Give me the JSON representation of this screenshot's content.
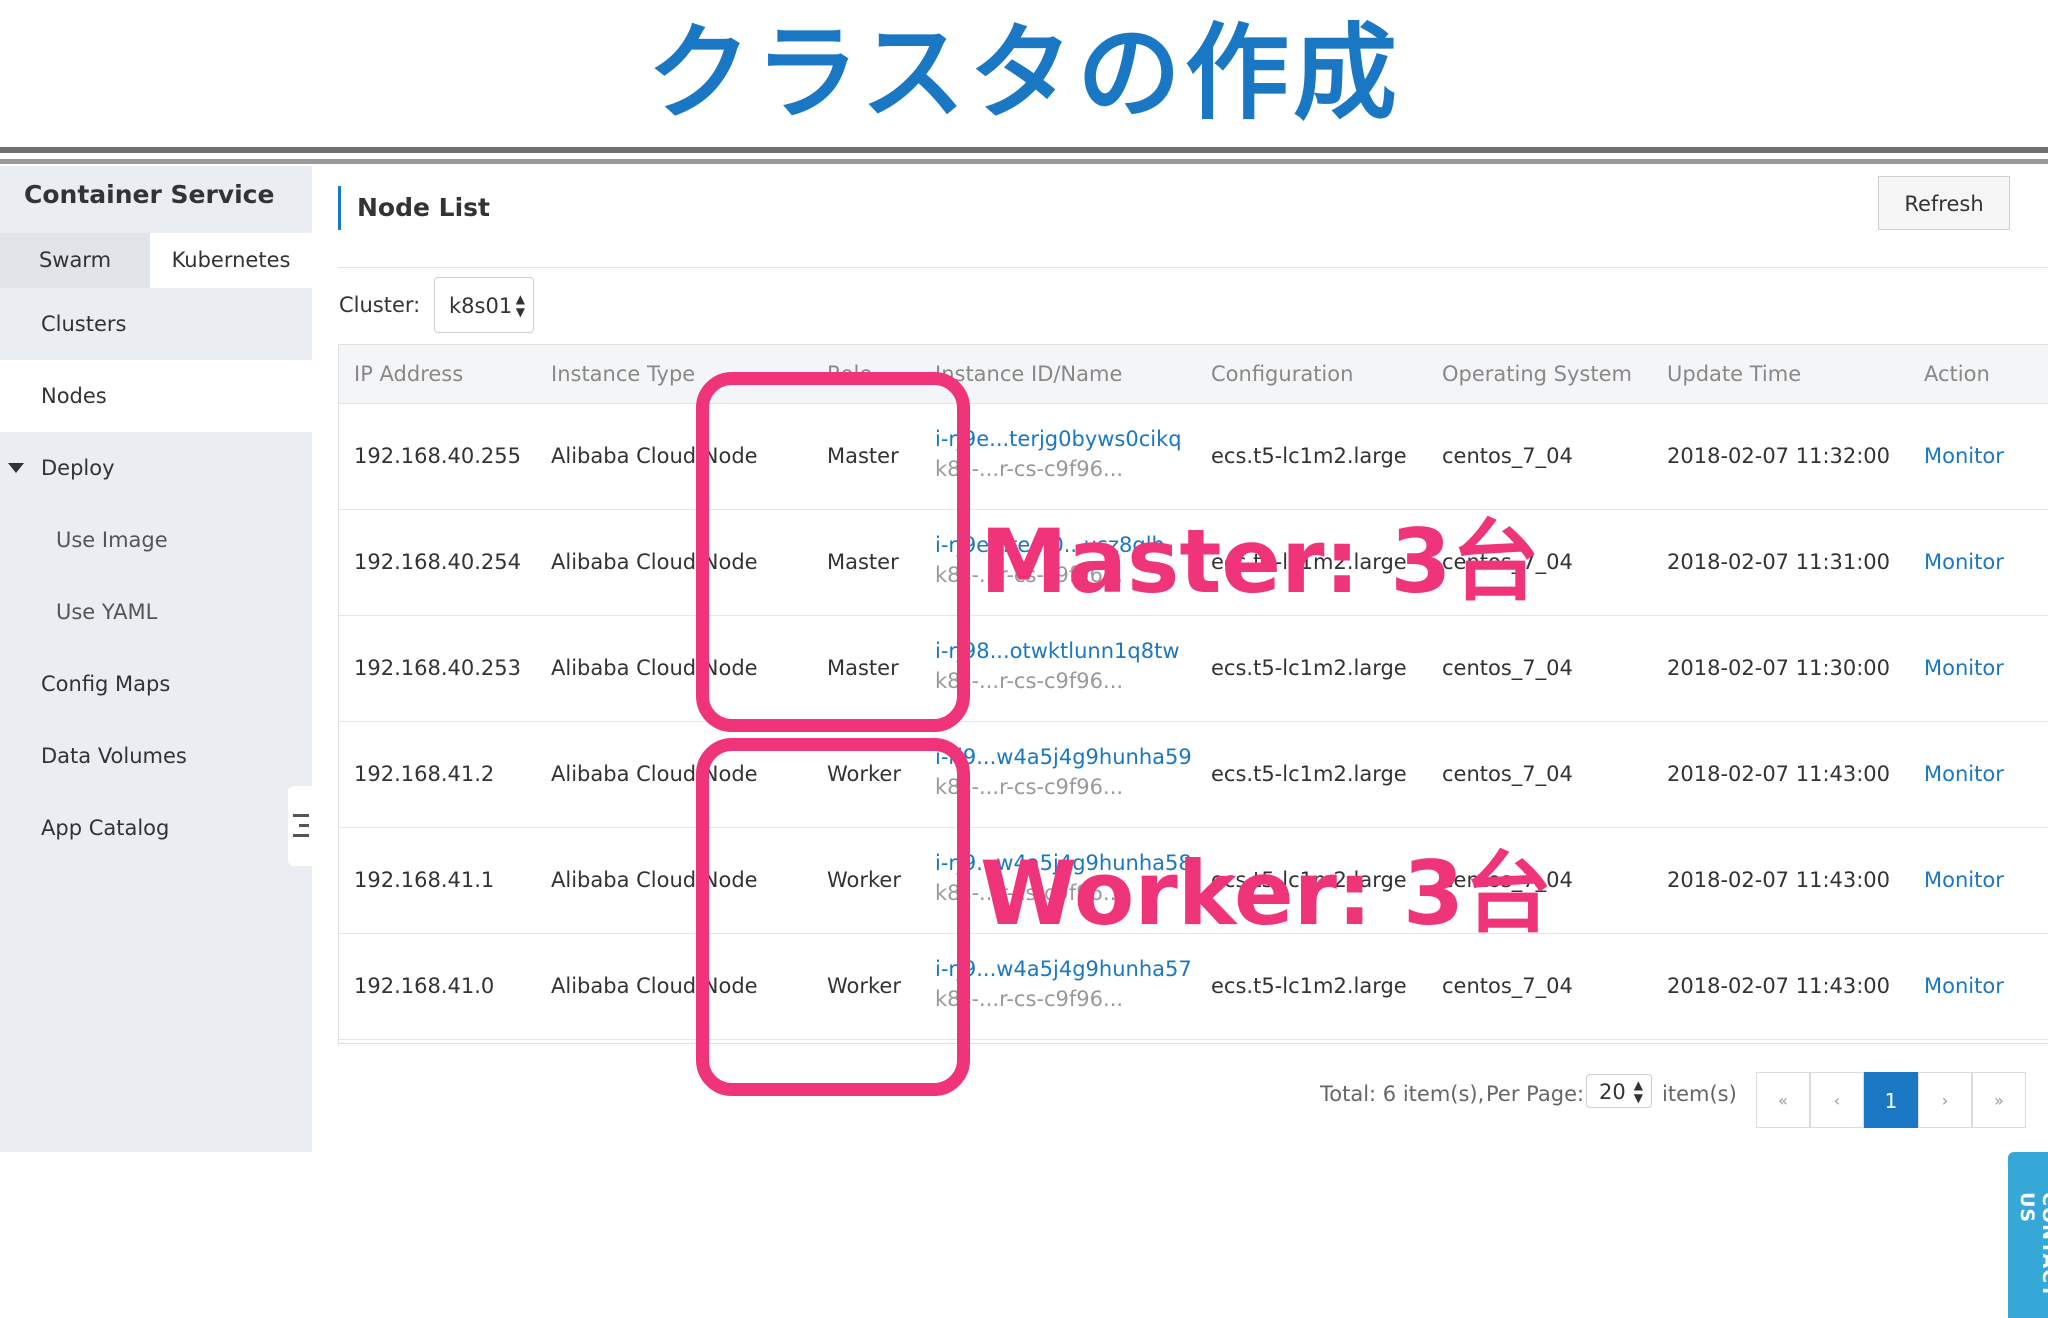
{
  "slide": {
    "title": "クラスタの作成"
  },
  "sidebar": {
    "brand": "Container Service",
    "tabs": [
      {
        "label": "Swarm"
      },
      {
        "label": "Kubernetes"
      }
    ],
    "items": [
      {
        "label": "Clusters"
      },
      {
        "label": "Nodes"
      },
      {
        "label": "Deploy"
      },
      {
        "label": "Use Image"
      },
      {
        "label": "Use YAML"
      },
      {
        "label": "Config Maps"
      },
      {
        "label": "Data Volumes"
      },
      {
        "label": "App Catalog"
      }
    ]
  },
  "page": {
    "title": "Node List",
    "refresh_label": "Refresh"
  },
  "filter": {
    "cluster_label": "Cluster:",
    "cluster_value": "k8s01"
  },
  "table": {
    "columns": [
      "IP Address",
      "Instance Type",
      "Role",
      "Instance ID/Name",
      "Configuration",
      "Operating System",
      "Update Time",
      "Action"
    ],
    "rows": [
      {
        "ip": "192.168.40.255",
        "type": "Alibaba Cloud Node",
        "role": "Master",
        "id": "i-rj9e...terjg0byws0cikq",
        "name": "k8s-...r-cs-c9f96...",
        "config": "ecs.t5-lc1m2.large",
        "os": "centos_7_04",
        "time": "2018-02-07 11:32:00",
        "action": "Monitor"
      },
      {
        "ip": "192.168.40.254",
        "type": "Alibaba Cloud Node",
        "role": "Master",
        "id": "i-rj9e...te...0...usz8qlh",
        "name": "k8s-...r-cs-c9f96...",
        "config": "ecs.t5-lc1m2.large",
        "os": "centos_7_04",
        "time": "2018-02-07 11:31:00",
        "action": "Monitor"
      },
      {
        "ip": "192.168.40.253",
        "type": "Alibaba Cloud Node",
        "role": "Master",
        "id": "i-rj98...otwktlunn1q8tw",
        "name": "k8s-...r-cs-c9f96...",
        "config": "ecs.t5-lc1m2.large",
        "os": "centos_7_04",
        "time": "2018-02-07 11:30:00",
        "action": "Monitor"
      },
      {
        "ip": "192.168.41.2",
        "type": "Alibaba Cloud Node",
        "role": "Worker",
        "id": "i-rj9...w4a5j4g9hunha59",
        "name": "k8s-...r-cs-c9f96...",
        "config": "ecs.t5-lc1m2.large",
        "os": "centos_7_04",
        "time": "2018-02-07 11:43:00",
        "action": "Monitor"
      },
      {
        "ip": "192.168.41.1",
        "type": "Alibaba Cloud Node",
        "role": "Worker",
        "id": "i-rj9...w4a5j4g9hunha58",
        "name": "k8s-...r-cs-c9f96...",
        "config": "ecs.t5-lc1m2.large",
        "os": "centos_7_04",
        "time": "2018-02-07 11:43:00",
        "action": "Monitor"
      },
      {
        "ip": "192.168.41.0",
        "type": "Alibaba Cloud Node",
        "role": "Worker",
        "id": "i-rj9...w4a5j4g9hunha57",
        "name": "k8s-...r-cs-c9f96...",
        "config": "ecs.t5-lc1m2.large",
        "os": "centos_7_04",
        "time": "2018-02-07 11:43:00",
        "action": "Monitor"
      }
    ]
  },
  "pagination": {
    "total_text": "Total: 6 item(s),",
    "per_page_label": "Per Page:",
    "per_page_value": "20",
    "items_label": "item(s)",
    "buttons": [
      "«",
      "‹",
      "1",
      "›",
      "»"
    ],
    "current_page": "1"
  },
  "contact": {
    "label": "CONTACT US"
  },
  "annotations": {
    "master": "Master: 3台",
    "worker": "Worker: 3台",
    "color": "#f0347a"
  },
  "colors": {
    "accent": "#1a77c4",
    "annotation": "#f0347a",
    "sidebar_bg": "#eaedf1"
  }
}
